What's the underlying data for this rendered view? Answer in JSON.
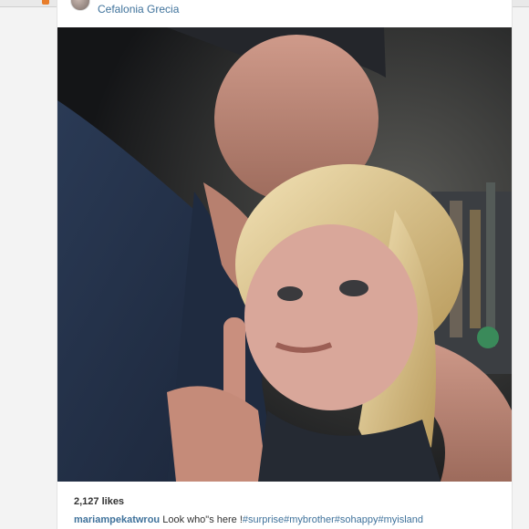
{
  "location": "Cefalonia Grecia",
  "photo": {
    "alt": ""
  },
  "likes": "2,127 likes",
  "caption": {
    "username": "mariampekatwrou",
    "text": " Look who\"s here !",
    "hashtags": [
      "#surprise",
      "#mybrother",
      "#sohappy",
      "#myisland"
    ]
  },
  "colors": {
    "link": "#3f729b",
    "favicon": "#e87d2b"
  }
}
